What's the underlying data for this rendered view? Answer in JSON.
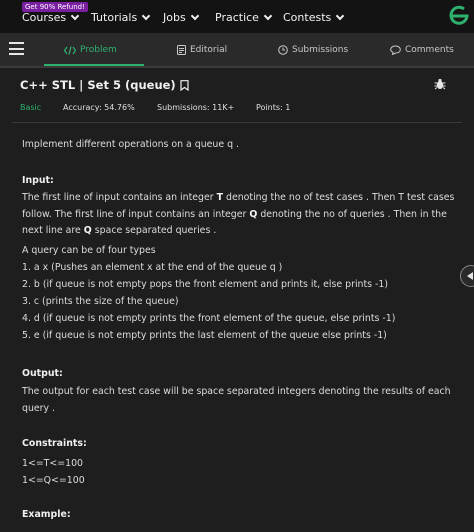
{
  "topnav": {
    "promo": "Get 90% Refund!",
    "items": [
      "Courses",
      "Tutorials",
      "Jobs",
      "Practice",
      "Contests"
    ]
  },
  "tabs": {
    "problem": "Problem",
    "editorial": "Editorial",
    "submissions": "Submissions",
    "comments": "Comments"
  },
  "problem": {
    "title": "C++ STL | Set 5 (queue)",
    "difficulty": "Basic",
    "accuracy": "Accuracy: 54.76%",
    "submissions": "Submissions: 11K+",
    "points": "Points: 1",
    "intro": "Implement different operations on a queue q .",
    "input_heading": "Input:",
    "input_p1_a": "The first line of input contains an integer ",
    "input_p1_T": "T",
    "input_p1_b": " denoting the no of test cases . Then T test cases follow. The first line of input contains an integer ",
    "input_p1_Q": "Q",
    "input_p1_c": " denoting the no of queries . Then in the next line are ",
    "input_p1_Q2": "Q",
    "input_p1_d": " space separated queries .",
    "query_intro": "A query can be of four types",
    "queries": [
      "1. a x (Pushes an element x at the end of the queue q )",
      "2. b (if queue is not empty pops the front element and prints it, else prints -1)",
      "3. c (prints the size of the queue)",
      "4. d (if queue is not empty prints the front element of the queue, else prints -1)",
      "5. e (if queue is not empty prints the last element of the queue else prints -1)"
    ],
    "output_heading": "Output:",
    "output_text": "The output for each test case will  be space separated integers denoting the results of each query .",
    "constraints_heading": "Constraints:",
    "constraints": [
      "1<=T<=100",
      "1<=Q<=100"
    ],
    "example_heading": "Example:"
  },
  "colors": {
    "accent": "#2fb16e",
    "background": "#1e1e1e",
    "promo": "#7a1fa2"
  }
}
